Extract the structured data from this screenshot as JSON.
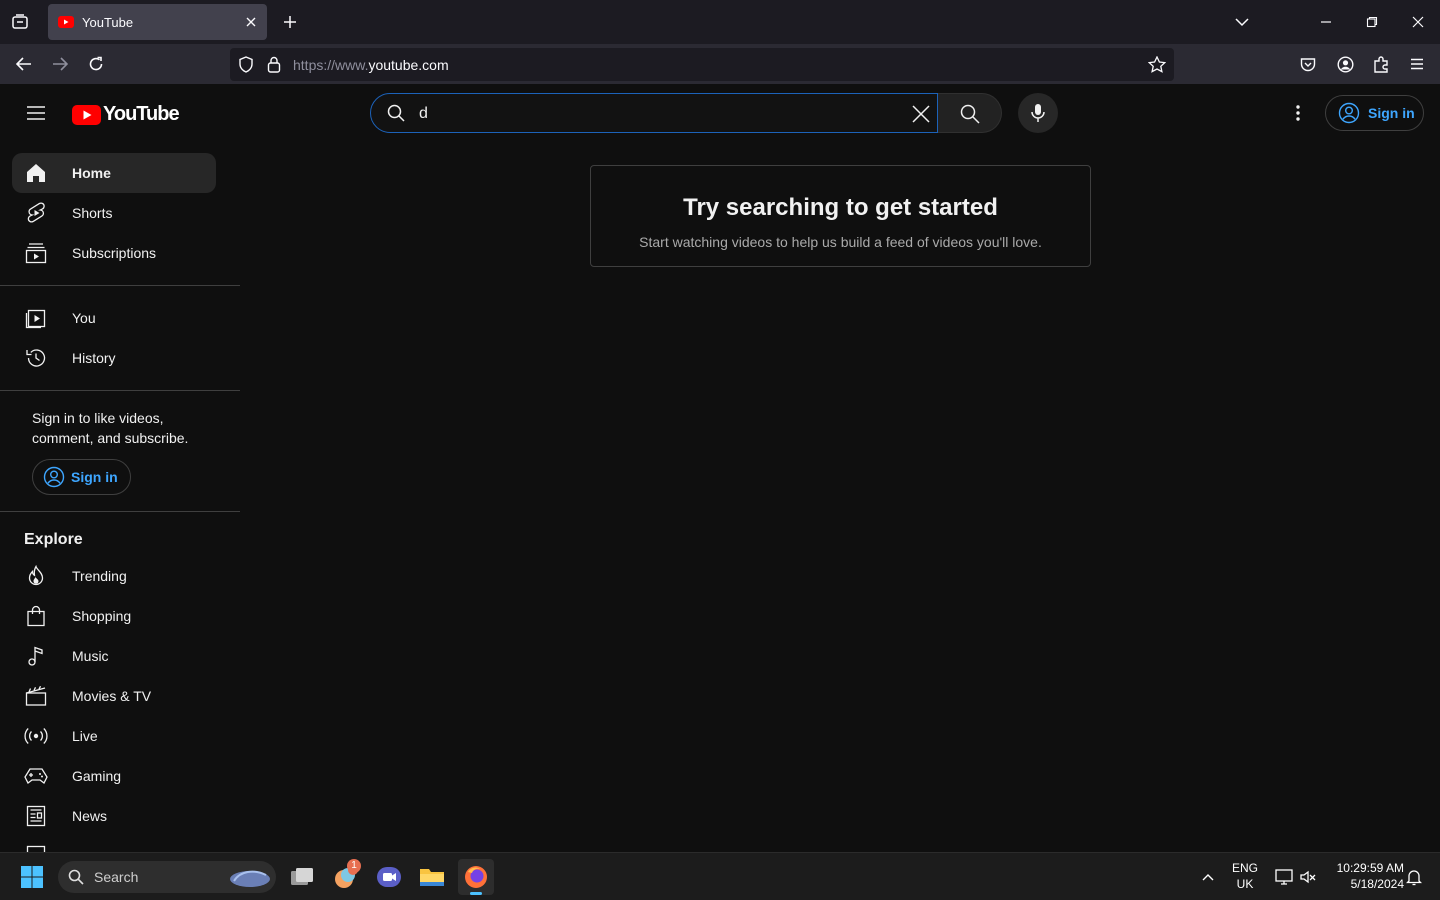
{
  "browser": {
    "tab_title": "YouTube",
    "url_scheme": "https://www.",
    "url_host": "youtube.com"
  },
  "youtube": {
    "logo_text": "YouTube",
    "search_value": "d",
    "signin_label": "Sign in",
    "sidebar": {
      "main_items": [
        {
          "label": "Home",
          "icon": "home-icon"
        },
        {
          "label": "Shorts",
          "icon": "shorts-icon"
        },
        {
          "label": "Subscriptions",
          "icon": "subscriptions-icon"
        }
      ],
      "you_items": [
        {
          "label": "You",
          "icon": "you-icon"
        },
        {
          "label": "History",
          "icon": "history-icon"
        }
      ],
      "signin_prompt": "Sign in to like videos, comment, and subscribe.",
      "signin_label": "Sign in",
      "explore_heading": "Explore",
      "explore_items": [
        {
          "label": "Trending",
          "icon": "trending-icon"
        },
        {
          "label": "Shopping",
          "icon": "shopping-icon"
        },
        {
          "label": "Music",
          "icon": "music-icon"
        },
        {
          "label": "Movies & TV",
          "icon": "movies-icon"
        },
        {
          "label": "Live",
          "icon": "live-icon"
        },
        {
          "label": "Gaming",
          "icon": "gaming-icon"
        },
        {
          "label": "News",
          "icon": "news-icon"
        }
      ]
    },
    "empty_state": {
      "title": "Try searching to get started",
      "subtitle": "Start watching videos to help us build a feed of videos you'll love."
    }
  },
  "taskbar": {
    "search_label": "Search",
    "lang_line1": "ENG",
    "lang_line2": "UK",
    "time": "10:29:59 AM",
    "date": "5/18/2024",
    "badge_count": "1"
  },
  "colors": {
    "accent_blue": "#3ea6ff",
    "youtube_red": "#ff0000",
    "background": "#0f0f0f"
  }
}
